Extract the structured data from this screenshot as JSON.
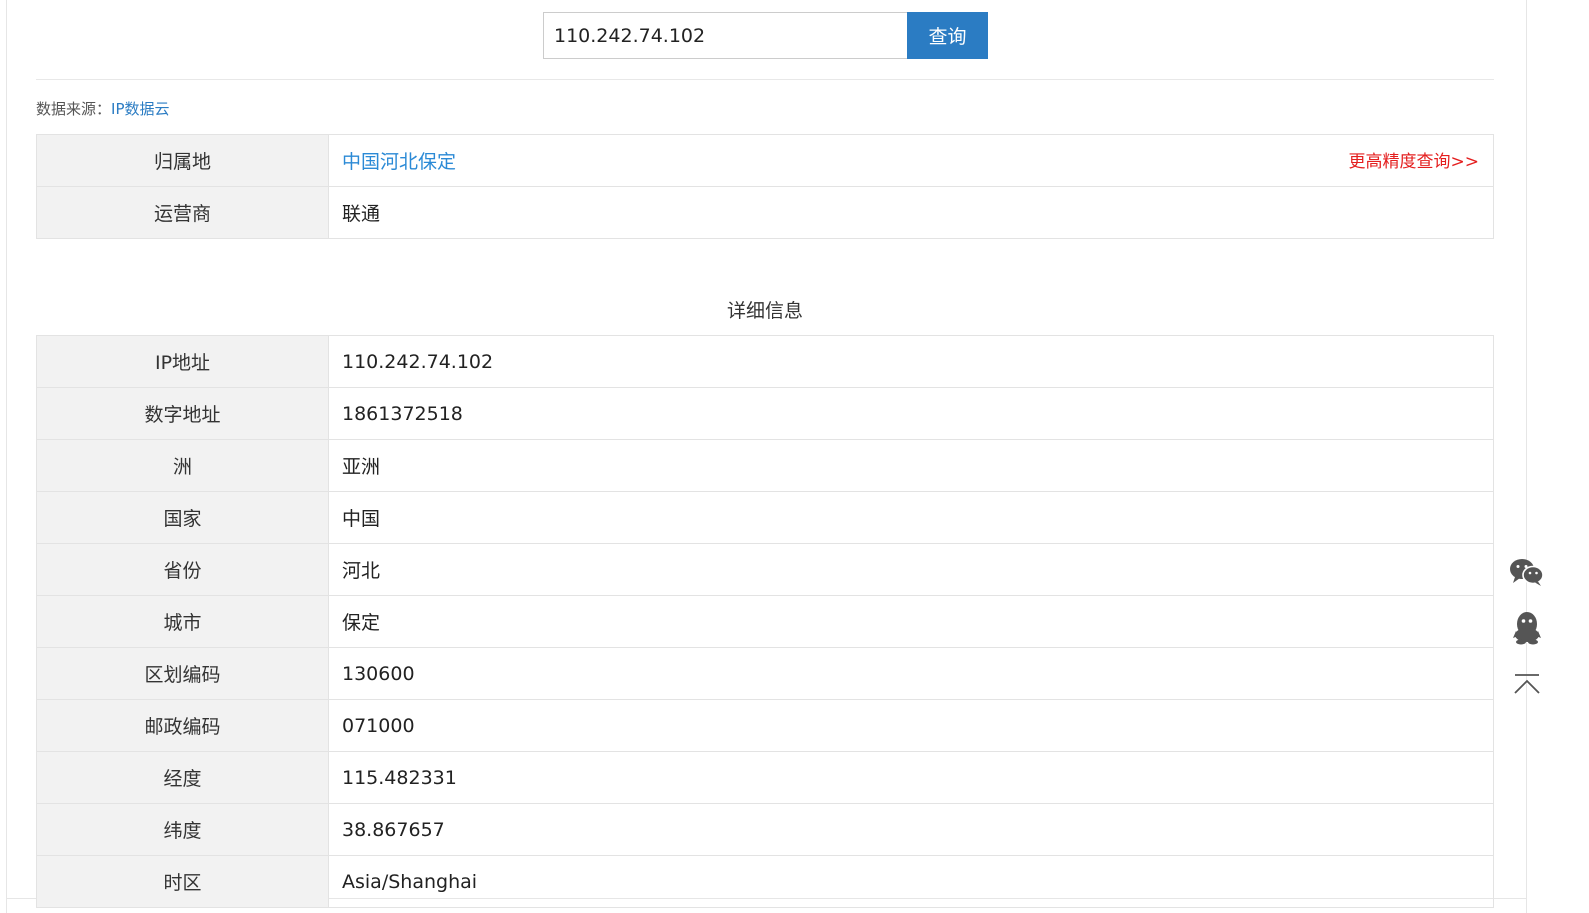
{
  "search": {
    "input_value": "110.242.74.102",
    "button_label": "查询"
  },
  "source": {
    "label": "数据来源：",
    "link_text": "IP数据云"
  },
  "summary": {
    "rows": [
      {
        "key": "归属地",
        "value": "中国河北保定",
        "action": "更高精度查询>>"
      },
      {
        "key": "运营商",
        "value": "联通"
      }
    ]
  },
  "details": {
    "title": "详细信息",
    "rows": [
      {
        "key": "IP地址",
        "value": "110.242.74.102"
      },
      {
        "key": "数字地址",
        "value": "1861372518"
      },
      {
        "key": "洲",
        "value": "亚洲"
      },
      {
        "key": "国家",
        "value": "中国"
      },
      {
        "key": "省份",
        "value": "河北"
      },
      {
        "key": "城市",
        "value": "保定"
      },
      {
        "key": "区划编码",
        "value": "130600"
      },
      {
        "key": "邮政编码",
        "value": "071000"
      },
      {
        "key": "经度",
        "value": "115.482331"
      },
      {
        "key": "纬度",
        "value": "38.867657"
      },
      {
        "key": "时区",
        "value": "Asia/Shanghai"
      }
    ]
  },
  "float_tools": {
    "icons": [
      "wechat-icon",
      "qq-icon",
      "back-to-top-icon"
    ]
  },
  "colors": {
    "primary_blue": "#2b7cc3",
    "link_blue": "#2b8ad6",
    "accent_red": "#e41e1e",
    "key_cell_bg": "#f2f2f2",
    "border": "#e3e3e3",
    "tool_icon": "#555555"
  }
}
